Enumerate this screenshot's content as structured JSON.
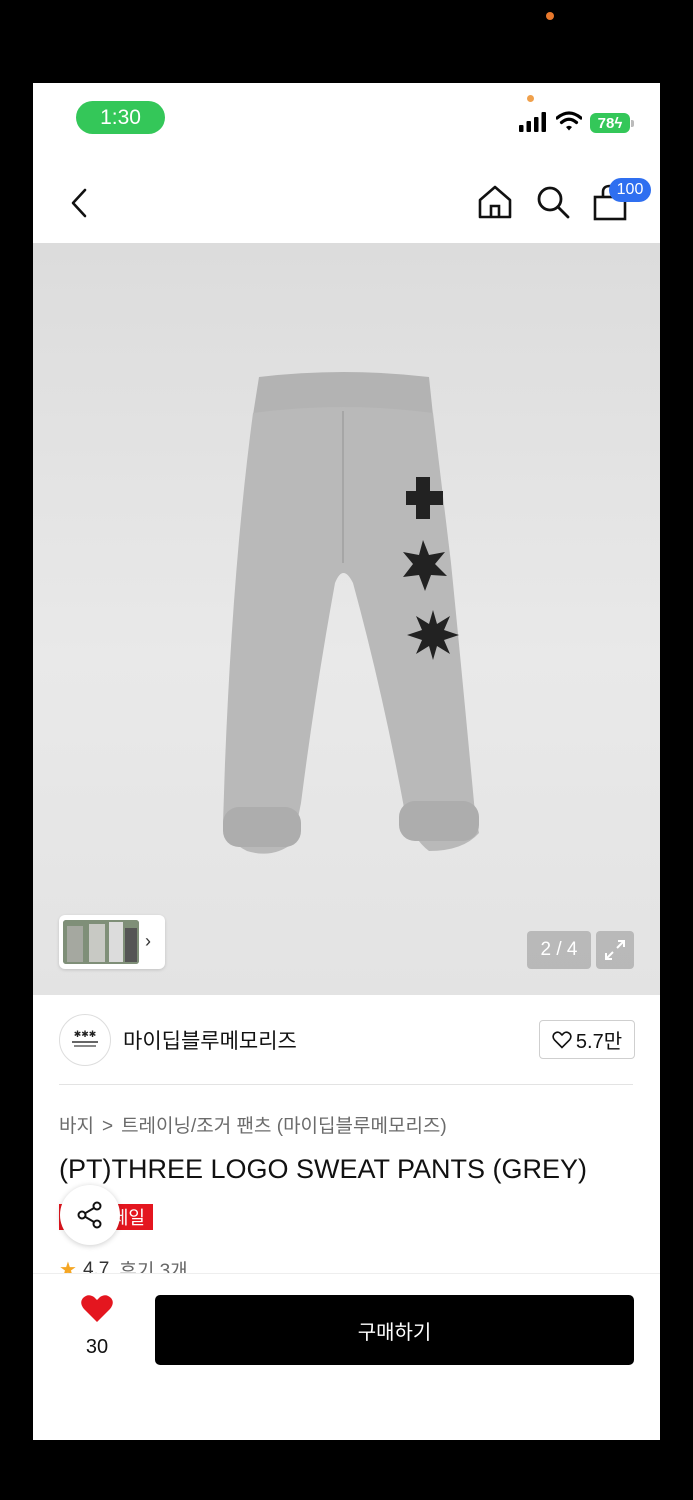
{
  "status_bar": {
    "time": "1:30",
    "battery": "78"
  },
  "nav": {
    "cart_count": "100",
    "icons": [
      "back-icon",
      "home-icon",
      "search-icon",
      "shopping-bag-icon"
    ]
  },
  "gallery": {
    "counter": "2 / 4"
  },
  "brand": {
    "name": "마이딥블루메모리즈",
    "likes": "5.7만"
  },
  "breadcrumb": {
    "category": "바지",
    "separator": ">",
    "subcategory": "트레이닝/조거 팬츠 (마이딥블루메모리즈)"
  },
  "product": {
    "title": "(PT)THREE LOGO SWEAT PANTS (GREY)",
    "sale_label": "세일"
  },
  "rating": {
    "score": "4.7",
    "reviews": "후기 3개"
  },
  "bottom_bar": {
    "wishlist_count": "30",
    "buy_label": "구매하기"
  },
  "colors": {
    "accent_blue": "#2f6ff0",
    "sale_red": "#e4161f",
    "heart_red": "#e4161f",
    "status_green": "#34c759"
  }
}
